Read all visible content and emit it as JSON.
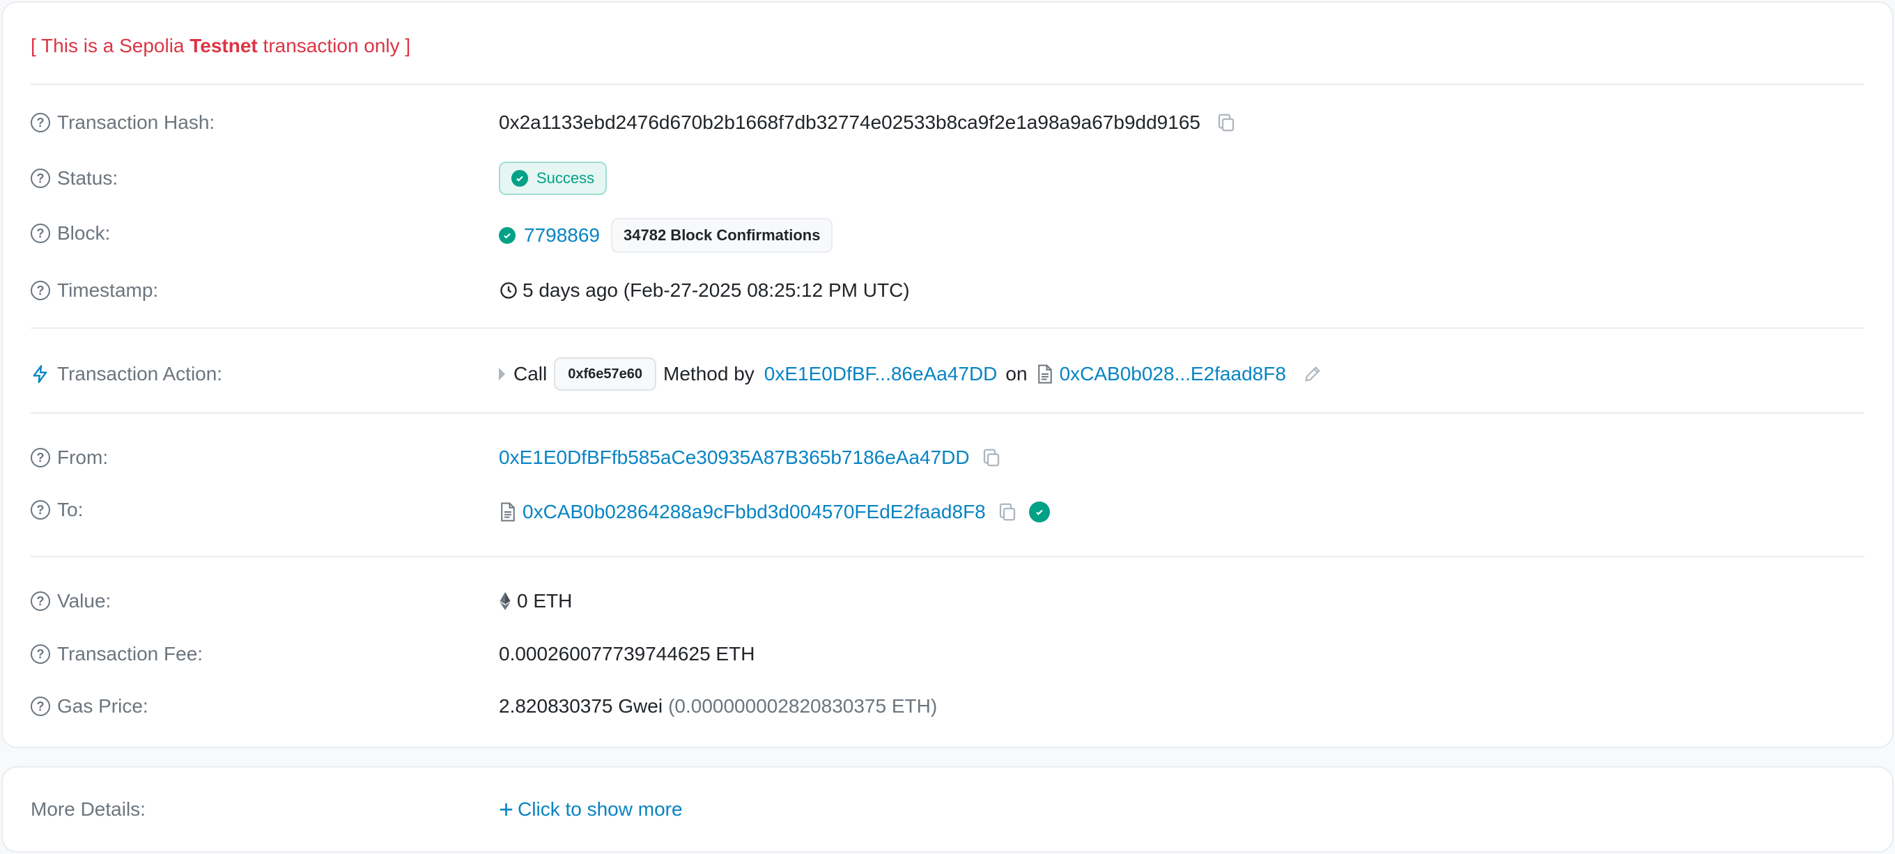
{
  "banner": {
    "prefix": "[ This is a Sepolia ",
    "emphasis": "Testnet",
    "suffix": " transaction only ]"
  },
  "rows": {
    "hash": {
      "label": "Transaction Hash:",
      "value": "0x2a1133ebd2476d670b2b1668f7db32774e02533b8ca9f2e1a98a9a67b9dd9165"
    },
    "status": {
      "label": "Status:",
      "value": "Success"
    },
    "block": {
      "label": "Block:",
      "number": "7798869",
      "confirmations": "34782 Block Confirmations"
    },
    "timestamp": {
      "label": "Timestamp:",
      "value": "5 days ago (Feb-27-2025 08:25:12 PM UTC)"
    },
    "action": {
      "label": "Transaction Action:",
      "call": "Call",
      "method_id": "0xf6e57e60",
      "method_by": "Method by",
      "from_short": "0xE1E0DfBF...86eAa47DD",
      "on": "on",
      "to_short": "0xCAB0b028...E2faad8F8"
    },
    "from": {
      "label": "From:",
      "value": "0xE1E0DfBFfb585aCe30935A87B365b7186eAa47DD"
    },
    "to": {
      "label": "To:",
      "value": "0xCAB0b02864288a9cFbbd3d004570FEdE2faad8F8"
    },
    "value": {
      "label": "Value:",
      "value": "0 ETH"
    },
    "fee": {
      "label": "Transaction Fee:",
      "value": "0.000260077739744625 ETH"
    },
    "gas": {
      "label": "Gas Price:",
      "gwei": "2.820830375 Gwei",
      "eth": "(0.000000002820830375 ETH)"
    }
  },
  "more": {
    "label": "More Details:",
    "link": "Click to show more"
  },
  "colors": {
    "link": "#0784c3",
    "success": "#00a186",
    "danger": "#dc3545",
    "muted": "#6c757d"
  }
}
